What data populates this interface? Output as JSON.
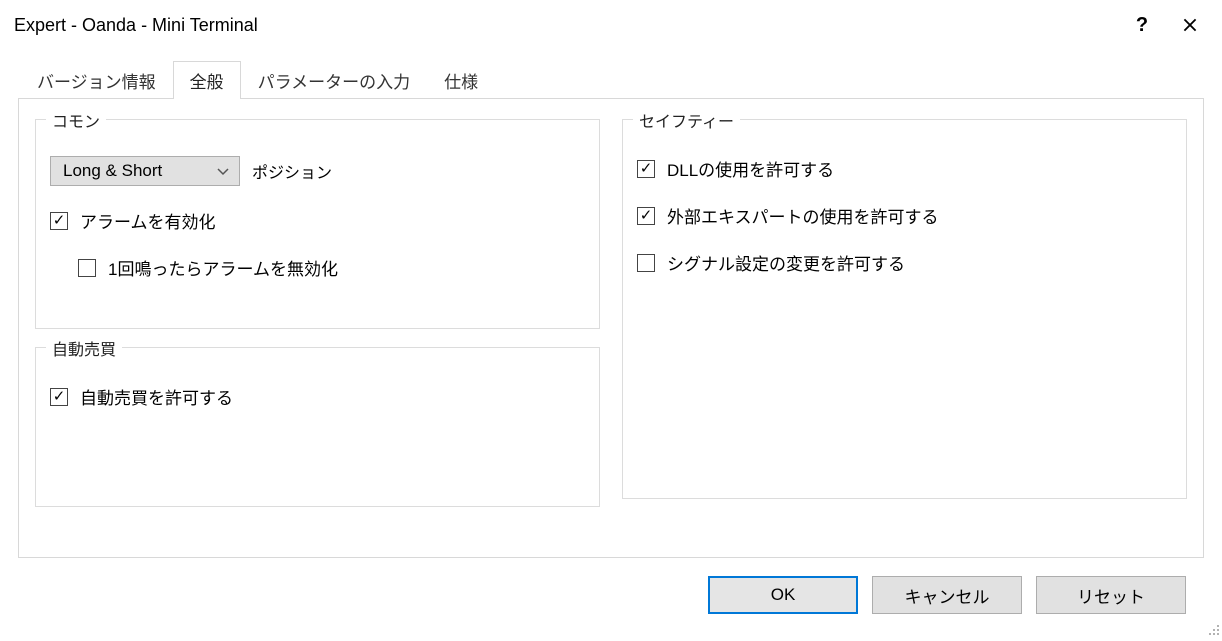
{
  "window": {
    "title": "Expert - Oanda - Mini Terminal"
  },
  "tabs": {
    "version": "バージョン情報",
    "general": "全般",
    "params": "パラメーターの入力",
    "spec": "仕様"
  },
  "groups": {
    "common": "コモン",
    "auto": "自動売買",
    "safety": "セイフティー"
  },
  "common": {
    "position_combo_value": "Long & Short",
    "position_label": "ポジション",
    "enable_alarm": "アラームを有効化",
    "disable_after_one": "1回鳴ったらアラームを無効化"
  },
  "auto": {
    "allow_auto": "自動売買を許可する"
  },
  "safety": {
    "allow_dll": "DLLの使用を許可する",
    "allow_ext_exp": "外部エキスパートの使用を許可する",
    "allow_sig_mod": "シグナル設定の変更を許可する"
  },
  "buttons": {
    "ok": "OK",
    "cancel": "キャンセル",
    "reset": "リセット"
  }
}
